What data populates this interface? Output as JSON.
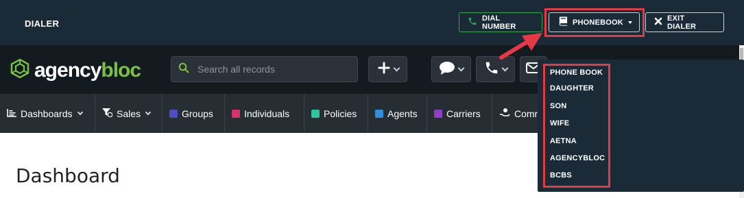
{
  "dialer": {
    "title": "DIALER",
    "dial_number_label": "DIAL NUMBER",
    "phonebook_label": "PHONEBOOK",
    "exit_dialer_label": "EXIT DIALER",
    "colors": {
      "bar": "#1b2a37",
      "dial_border": "#2fa84f",
      "highlight": "#e53945"
    }
  },
  "header": {
    "logo_agency": "agency",
    "logo_bloc": "bloc",
    "search_placeholder": "Search all records",
    "buttons": [
      "add-icon",
      "chat-icon",
      "phone-icon",
      "mail-icon"
    ],
    "colors": {
      "bg": "#131a20",
      "logo_green": "#79c142"
    }
  },
  "nav": {
    "items": [
      {
        "label": "Dashboards",
        "icon": "chart-icon",
        "dropdown": true
      },
      {
        "label": "Sales",
        "icon": "filter-icon",
        "dropdown": true
      },
      {
        "label": "Groups",
        "color": "#4b4fc4"
      },
      {
        "label": "Individuals",
        "color": "#d6336c"
      },
      {
        "label": "Policies",
        "color": "#2ec4a0"
      },
      {
        "label": "Agents",
        "color": "#2f8fdc"
      },
      {
        "label": "Carriers",
        "color": "#8e3fc8"
      },
      {
        "label": "Comr",
        "icon": "commission-icon"
      }
    ]
  },
  "main": {
    "title": "Dashboard"
  },
  "phonebook_menu": {
    "items": [
      "PHONE BOOK",
      "DAUGHTER",
      "SON",
      "WIFE",
      "AETNA",
      "AGENCYBLOC",
      "BCBS"
    ]
  }
}
